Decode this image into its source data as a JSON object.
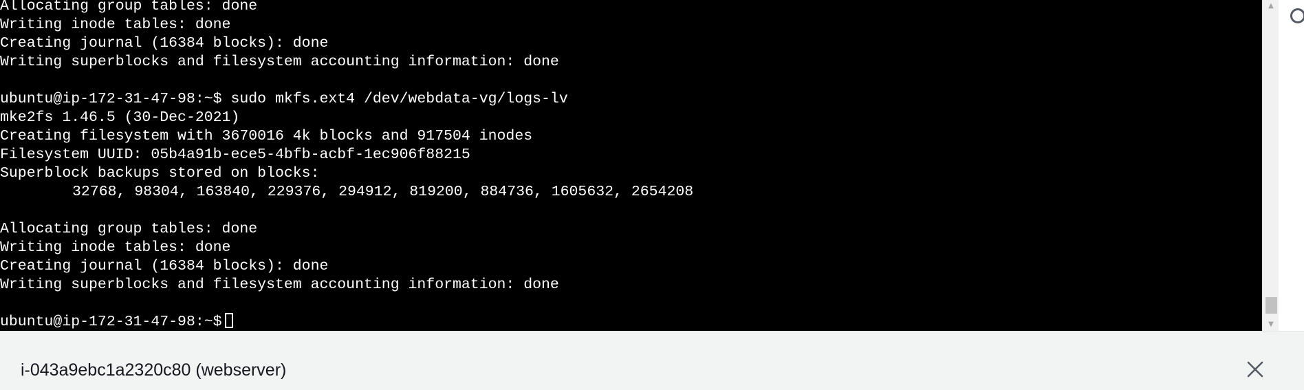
{
  "terminal": {
    "lines": [
      "Allocating group tables: done",
      "Writing inode tables: done",
      "Creating journal (16384 blocks): done",
      "Writing superblocks and filesystem accounting information: done",
      "",
      "ubuntu@ip-172-31-47-98:~$ sudo mkfs.ext4 /dev/webdata-vg/logs-lv",
      "mke2fs 1.46.5 (30-Dec-2021)",
      "Creating filesystem with 3670016 4k blocks and 917504 inodes",
      "Filesystem UUID: 05b4a91b-ece5-4bfb-acbf-1ec906f88215",
      "Superblock backups stored on blocks:",
      "32768, 98304, 163840, 229376, 294912, 819200, 884736, 1605632, 2654208",
      "",
      "Allocating group tables: done",
      "Writing inode tables: done",
      "Creating journal (16384 blocks): done",
      "Writing superblocks and filesystem accounting information: done",
      ""
    ],
    "prompt": "ubuntu@ip-172-31-47-98:~$",
    "background": "#000000",
    "foreground": "#ffffff"
  },
  "scrollbar": {
    "up_icon": "triangle-up-icon",
    "down_icon": "triangle-down-icon"
  },
  "bottom_panel": {
    "instance_title": "i-043a9ebc1a2320c80 (webserver)",
    "close_icon": "close-icon"
  }
}
